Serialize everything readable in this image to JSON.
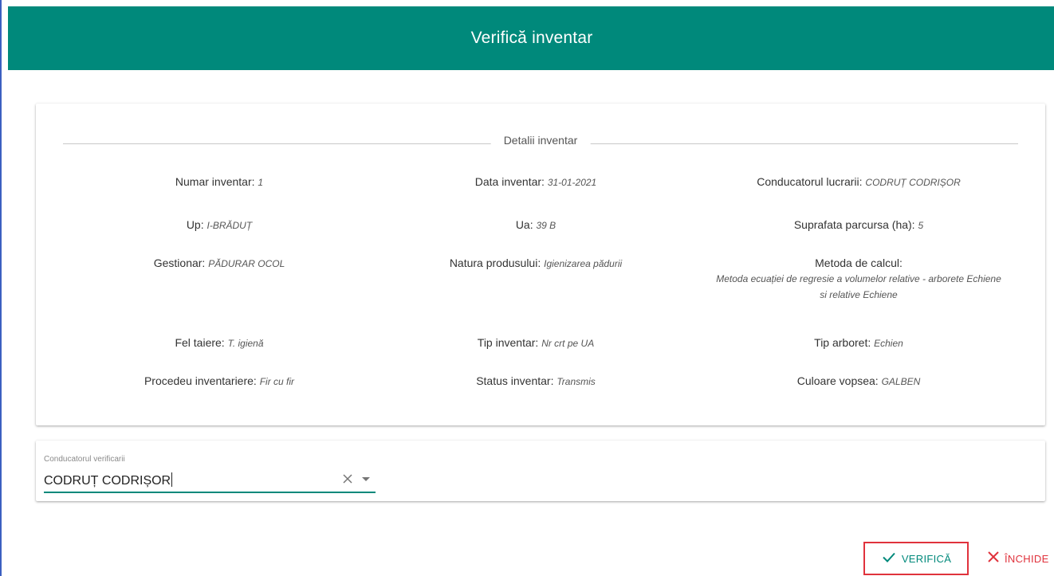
{
  "colors": {
    "accent": "#00897b",
    "danger": "#e0323c"
  },
  "dialog": {
    "title": "Verifică inventar"
  },
  "details": {
    "legend": "Detalii inventar",
    "rows": [
      [
        {
          "label": "Numar inventar:",
          "value": "1"
        },
        {
          "label": "Data inventar:",
          "value": "31-01-2021"
        },
        {
          "label": "Conducatorul lucrarii:",
          "value": "CODRUȚ CODRIȘOR"
        }
      ],
      [
        {
          "label": "Up:",
          "value": "I-BRĂDUȚ"
        },
        {
          "label": "Ua:",
          "value": "39 B"
        },
        {
          "label": "Suprafata parcursa (ha):",
          "value": "5"
        }
      ],
      [
        {
          "label": "Gestionar:",
          "value": "PĂDURAR OCOL"
        },
        {
          "label": "Natura produsului:",
          "value": "Igienizarea pădurii"
        },
        {
          "label": "Metoda de calcul:",
          "value": "Metoda ecuației de regresie a volumelor relative - arborete Echiene si relative Echiene"
        }
      ],
      [
        {
          "label": "Fel taiere:",
          "value": "T. igienă"
        },
        {
          "label": "Tip inventar:",
          "value": "Nr crt pe UA"
        },
        {
          "label": "Tip arboret:",
          "value": "Echien"
        }
      ],
      [
        {
          "label": "Procedeu inventariere:",
          "value": "Fir cu fir"
        },
        {
          "label": "Status inventar:",
          "value": "Transmis"
        },
        {
          "label": "Culoare vopsea:",
          "value": "GALBEN"
        }
      ]
    ]
  },
  "verifier": {
    "label": "Conducatorul verificarii",
    "value": "CODRUȚ CODRIȘOR",
    "clear_icon": "close-icon",
    "dropdown_icon": "caret-down-icon"
  },
  "actions": {
    "verify_label": "VERIFICĂ",
    "verify_icon": "check-icon",
    "close_label": "ÎNCHIDE",
    "close_icon": "close-icon"
  }
}
